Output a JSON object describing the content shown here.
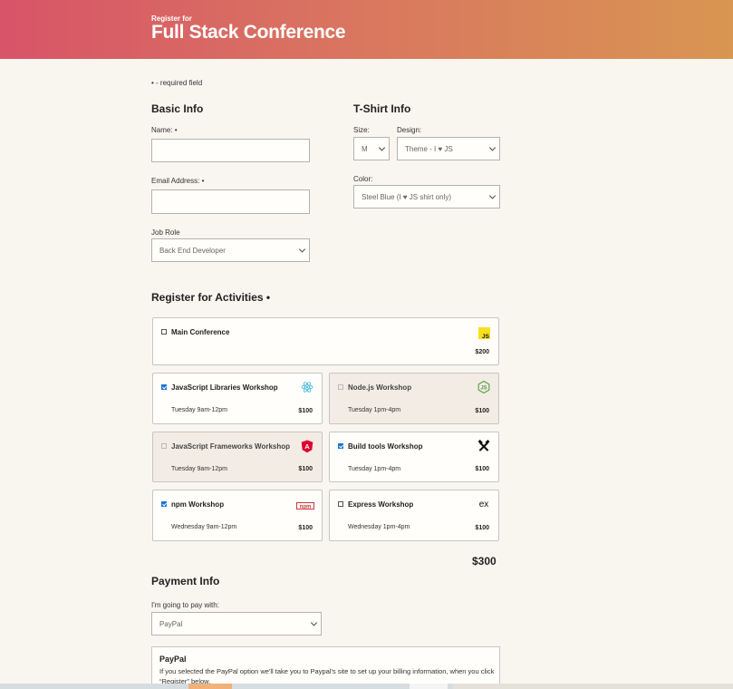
{
  "header": {
    "subtitle": "Register for",
    "title": "Full Stack Conference"
  },
  "required_note": "• - required field",
  "basic_info": {
    "heading": "Basic Info",
    "name_label": "Name: •",
    "email_label": "Email Address: •",
    "job_label": "Job Role",
    "job_value": "Back End Developer"
  },
  "tshirt": {
    "heading": "T-Shirt Info",
    "size_label": "Size:",
    "size_value": "M",
    "design_label": "Design:",
    "design_value": "Theme - I ♥ JS",
    "color_label": "Color:",
    "color_value": "Steel Blue (I ♥ JS shirt only)"
  },
  "activities": {
    "heading": "Register for Activities •",
    "items": [
      {
        "name": "Main Conference",
        "time": "",
        "price": "$200",
        "checked": false,
        "disabled": false,
        "icon": "js-icon",
        "icon_color": "#f7df1e"
      },
      {
        "name": "JavaScript Libraries Workshop",
        "time": "Tuesday 9am-12pm",
        "price": "$100",
        "checked": true,
        "disabled": false,
        "icon": "react-icon",
        "icon_color": "#53c1de"
      },
      {
        "name": "Node.js Workshop",
        "time": "Tuesday 1pm-4pm",
        "price": "$100",
        "checked": false,
        "disabled": true,
        "icon": "nodejs-icon",
        "icon_color": "#539e43"
      },
      {
        "name": "JavaScript Frameworks Workshop",
        "time": "Tuesday 9am-12pm",
        "price": "$100",
        "checked": false,
        "disabled": true,
        "icon": "angular-icon",
        "icon_color": "#dd0031"
      },
      {
        "name": "Build tools Workshop",
        "time": "Tuesday 1pm-4pm",
        "price": "$100",
        "checked": true,
        "disabled": false,
        "icon": "build-tools-icon",
        "icon_color": "#111111"
      },
      {
        "name": "npm Workshop",
        "time": "Wednesday 9am-12pm",
        "price": "$100",
        "checked": true,
        "disabled": false,
        "icon": "npm-icon",
        "icon_color": "#cb3837"
      },
      {
        "name": "Express Workshop",
        "time": "Wednesday 1pm-4pm",
        "price": "$100",
        "checked": false,
        "disabled": false,
        "icon": "express-icon",
        "icon_color": "#111111"
      }
    ],
    "total": "$300"
  },
  "payment": {
    "heading": "Payment Info",
    "method_label": "I'm going to pay with:",
    "method_value": "PayPal",
    "box_title": "PayPal",
    "box_text": "If you selected the PayPal option we'll take you to Paypal's site to set up your billing information, when you click “Register” below."
  },
  "colors": {
    "header_start": "#d85468",
    "header_end": "#d99552",
    "checkbox_checked": "#1976d2",
    "page_bg": "#f9f6f0"
  }
}
